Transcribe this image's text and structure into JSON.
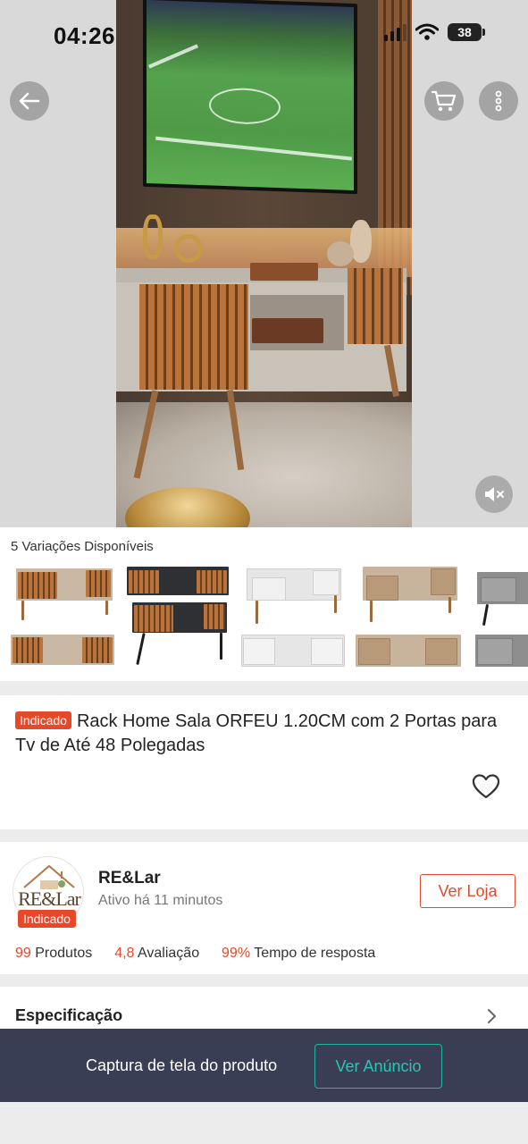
{
  "status_bar": {
    "time": "04:26",
    "battery": "38"
  },
  "media": {
    "icons": [
      "back-arrow-icon",
      "cart-icon",
      "more-vertical-icon",
      "mute-icon"
    ]
  },
  "variations": {
    "title": "5 Variações Disponíveis",
    "count": 5
  },
  "product": {
    "tag": "Indicado",
    "title": "Rack Home Sala ORFEU 1.20CM com 2 Portas para Tv de Até 48 Polegadas"
  },
  "store": {
    "logo_text": "RE&Lar",
    "tag": "Indicado",
    "name": "RE&Lar",
    "active": "Ativo há 11 minutos",
    "button": "Ver Loja",
    "stats": [
      {
        "value": "99",
        "label": "Produtos"
      },
      {
        "value": "4,8",
        "label": "Avaliação"
      },
      {
        "value": "99%",
        "label": "Tempo de resposta"
      }
    ]
  },
  "spec": {
    "label": "Especificação"
  },
  "bottom_bar": {
    "label": "Captura de tela do produto",
    "button": "Ver Anúncio"
  },
  "colors": {
    "accent": "#e8482a",
    "teal": "#23b3a3",
    "bar_bg": "#3a3e54"
  }
}
